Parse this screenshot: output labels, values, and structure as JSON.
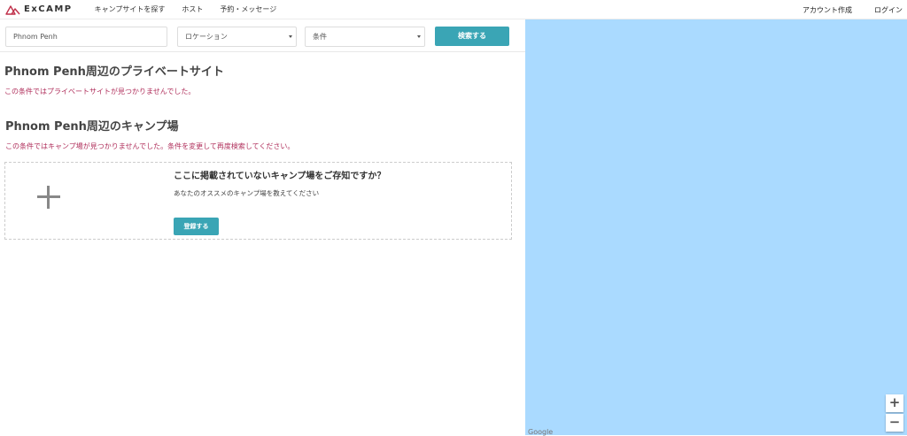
{
  "header": {
    "brand": "ExCAMP",
    "nav": [
      "キャンプサイトを探す",
      "ホスト",
      "予約・メッセージ"
    ],
    "right": [
      "アカウント作成",
      "ログイン"
    ]
  },
  "search": {
    "keyword": "Phnom Penh",
    "location_select": "ロケーション",
    "condition_select": "条件",
    "button": "検索する"
  },
  "private": {
    "title": "Phnom Penh周辺のプライベートサイト",
    "message": "この条件ではプライベートサイトが見つかりませんでした。"
  },
  "camp": {
    "title": "Phnom Penh周辺のキャンプ場",
    "message": "この条件ではキャンプ場が見つかりませんでした。条件を変更して再度検索してください。"
  },
  "suggest": {
    "title": "ここに掲載されていないキャンプ場をご存知ですか？",
    "subtitle": "あなたのオススメのキャンプ場を教えてください",
    "button": "登録する"
  },
  "map": {
    "zoom_in": "+",
    "zoom_out": "−",
    "attribution": "Google"
  },
  "colors": {
    "accent": "#3aa5b5",
    "error": "#b0305c",
    "map_water": "#aadaff",
    "logo": "#c0304a"
  }
}
